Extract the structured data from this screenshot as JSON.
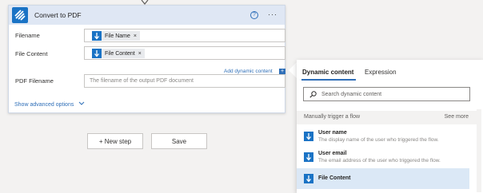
{
  "action": {
    "title": "Convert to PDF",
    "help_glyph": "?",
    "more_glyph": "···",
    "fields": [
      {
        "label": "Filename",
        "token": "File Name",
        "remove": "×"
      },
      {
        "label": "File Content",
        "token": "File Content",
        "remove": "×"
      },
      {
        "label": "PDF Filename",
        "placeholder": "The filename of the output PDF document"
      }
    ],
    "add_dynamic_label": "Add dynamic content",
    "add_dynamic_glyph": "+",
    "show_advanced": "Show advanced options"
  },
  "buttons": {
    "new_step": "+ New step",
    "save": "Save"
  },
  "dynamic_panel": {
    "tabs": [
      "Dynamic content",
      "Expression"
    ],
    "search_placeholder": "Search dynamic content",
    "section_title": "Manually trigger a flow",
    "see_more": "See more",
    "items": [
      {
        "name": "User name",
        "description": "The display name of the user who triggered the flow."
      },
      {
        "name": "User email",
        "description": "The email address of the user who triggered the flow."
      },
      {
        "name": "File Content",
        "description": ""
      }
    ]
  },
  "colors": {
    "accent": "#1a73c5",
    "link": "#2f6fb8",
    "header": "#dfe7f4",
    "canvas": "#f3f2f1",
    "selected_item": "#dbe8f6"
  },
  "icons": [
    "connector-arrow-icon",
    "pdf-connector-logo",
    "help-icon",
    "more-icon",
    "trigger-icon",
    "remove-icon",
    "plus-icon",
    "chevron-down-icon",
    "search-icon"
  ]
}
